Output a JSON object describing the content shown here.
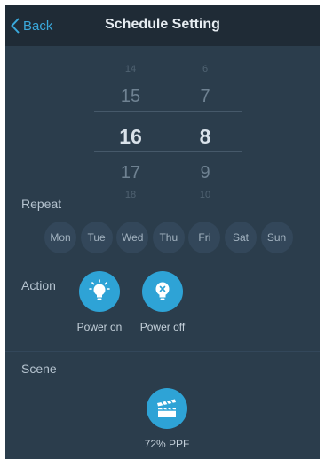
{
  "nav": {
    "back_label": "Back",
    "title": "Schedule Setting"
  },
  "picker": {
    "hours": [
      "14",
      "15",
      "16",
      "17",
      "18"
    ],
    "minutes": [
      "6",
      "7",
      "8",
      "9",
      "10"
    ],
    "selected_hour": "16",
    "selected_minute": "8"
  },
  "repeat": {
    "label": "Repeat",
    "days": [
      "Mon",
      "Tue",
      "Wed",
      "Thu",
      "Fri",
      "Sat",
      "Sun"
    ]
  },
  "action": {
    "label": "Action",
    "power_on_label": "Power on",
    "power_off_label": "Power off"
  },
  "scene": {
    "label": "Scene",
    "item_label": "72% PPF"
  },
  "colors": {
    "accent": "#2ea3d6",
    "background": "#2b3d4c",
    "navbar": "#1f2b36"
  }
}
